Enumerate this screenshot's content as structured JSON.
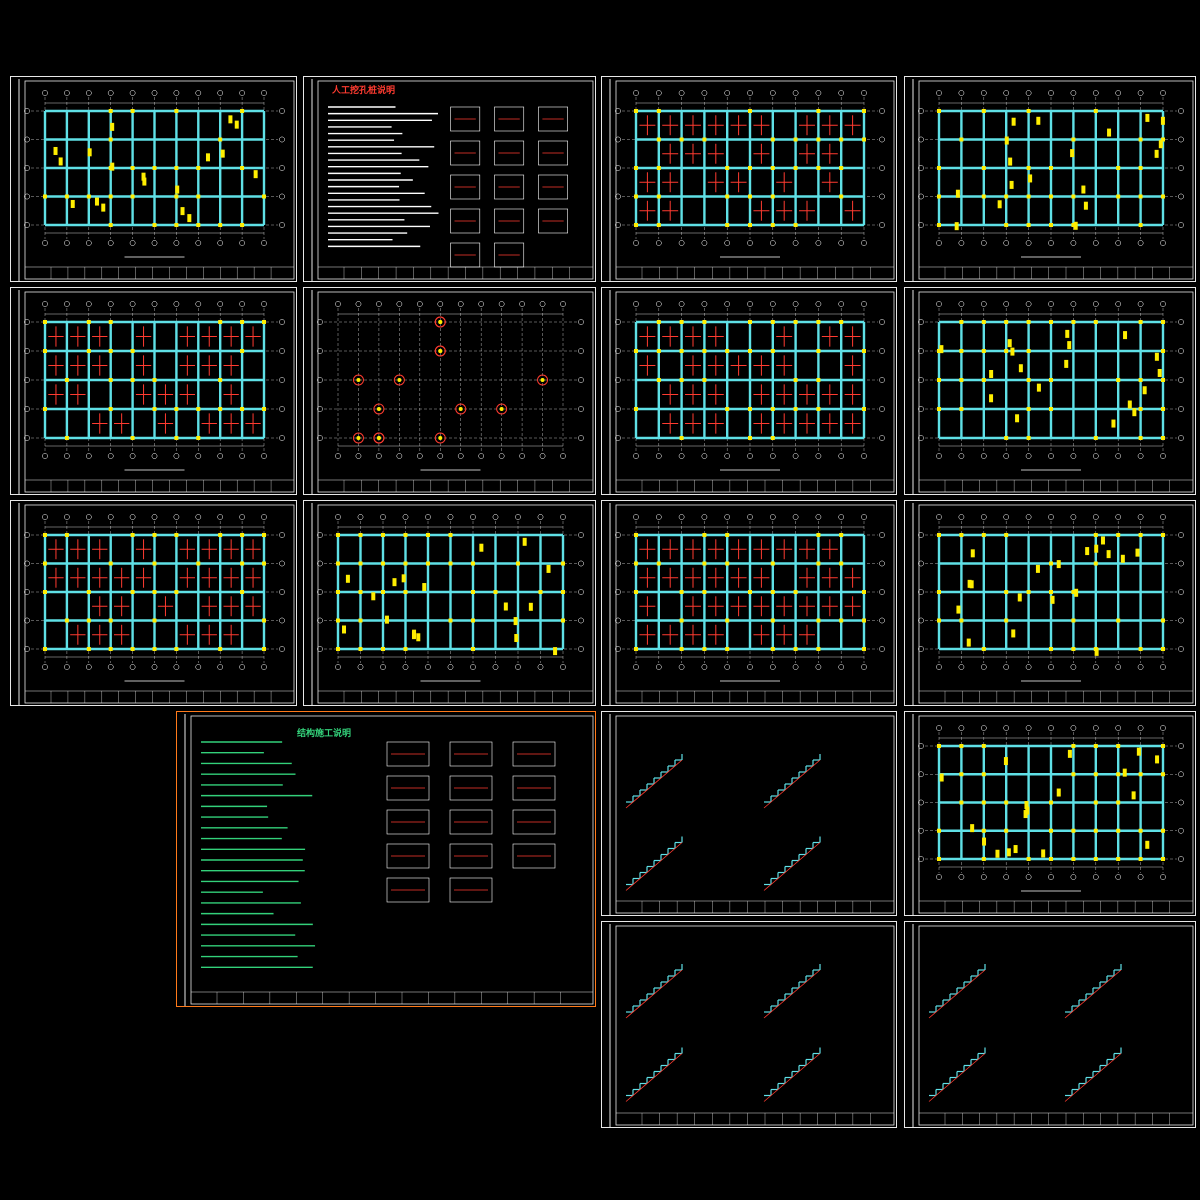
{
  "canvas": {
    "background": "#000000"
  },
  "colors": {
    "frame": "#e8e8e8",
    "beam": "#5fe0e6",
    "rebar": "#ff3b30",
    "column": "#ffee00",
    "grid": "#ffffff",
    "notes_text": "#33d17a",
    "orange_frame": "#ff7a1a",
    "dim": "#9aa0a6"
  },
  "sheets": {
    "pile_notes_title": "人工挖孔桩说明",
    "general_notes_title": "结构施工说明"
  },
  "icons": [
    "column-marker-icon",
    "axis-bubble-icon",
    "section-mark-icon"
  ]
}
